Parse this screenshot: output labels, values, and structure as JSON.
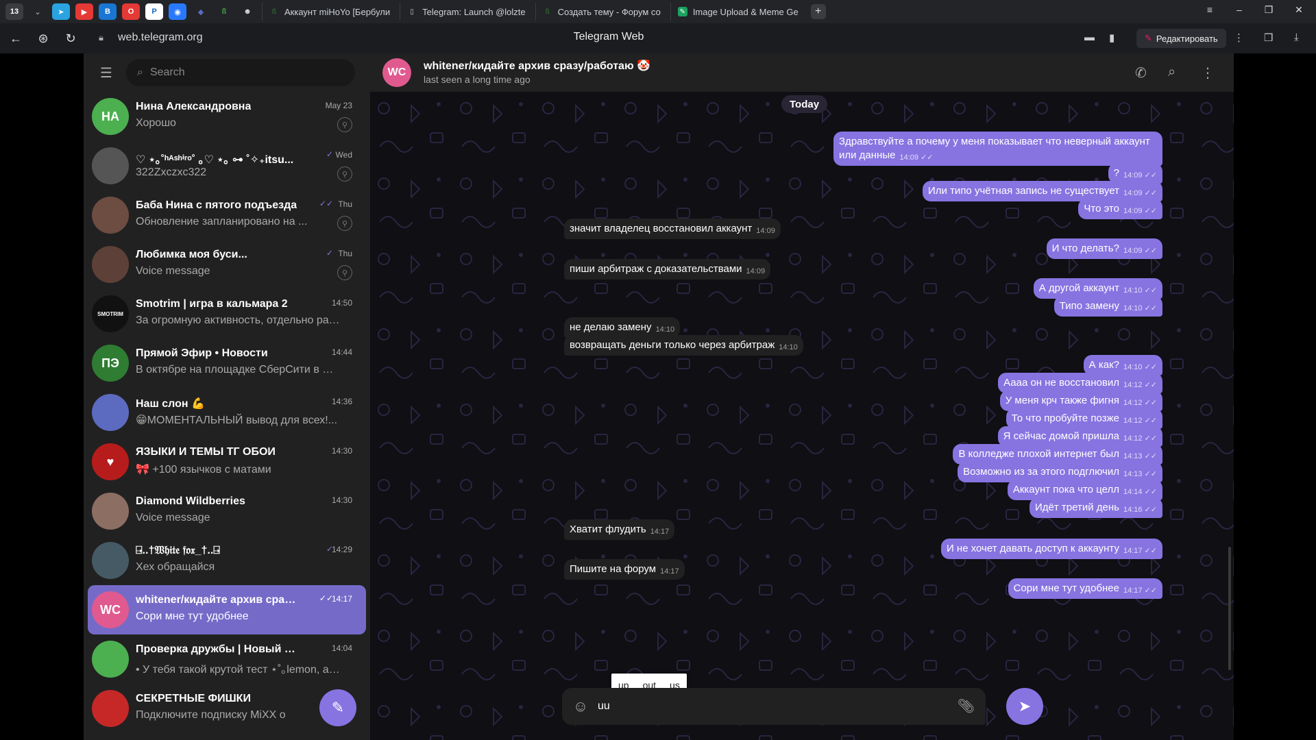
{
  "browser": {
    "tabs": [
      {
        "label": "Аккаунт miHoYo [Бербули",
        "icon": "lolz-icon",
        "color": "#2e7d32"
      },
      {
        "label": "Telegram: Launch @lolzte",
        "icon": "page-icon",
        "color": "#aaaaaa"
      },
      {
        "label": "Создать тему - Форум со",
        "icon": "lolz-icon",
        "color": "#2e7d32"
      },
      {
        "label": "Image Upload & Meme Ge",
        "icon": "imgflip-icon",
        "color": "#1aa260"
      }
    ],
    "badge_count": "13",
    "url": "web.telegram.org",
    "page_title": "Telegram Web",
    "edit_label": "Редактировать"
  },
  "sidebar": {
    "search_placeholder": "Search",
    "chats": [
      {
        "name": "Нина Александровна",
        "time": "May 23",
        "preview": "Хорошо",
        "avatar_text": "НА",
        "avatar_color": "#4caf50",
        "pinned": true,
        "check": ""
      },
      {
        "name": "♡ ⋆｡˚ʰᴬˢʰⁱʳᵒ˚ ｡♡ ⋆｡ ⊶ ˚✧₊itsu...",
        "time": "Wed",
        "preview": "322Zxczxc322",
        "avatar_text": "",
        "avatar_color": "#555555",
        "pinned": true,
        "check": "✓"
      },
      {
        "name": "Баба Нина с пятого подъезда",
        "time": "Thu",
        "preview": "Обновление запланировано на ...",
        "avatar_text": "",
        "avatar_color": "#6d4c41",
        "pinned": true,
        "check": "✓✓"
      },
      {
        "name": "Любимка моя буси...",
        "time": "Thu",
        "preview": "Voice message",
        "avatar_text": "",
        "avatar_color": "#5d4037",
        "pinned": true,
        "check": "✓"
      },
      {
        "name": "Smotrim | игра в кальмара 2",
        "time": "14:50",
        "preview": "За огромную активность, отдельно разы...",
        "avatar_text": "SMOTRIM",
        "avatar_color": "#111111",
        "pinned": false,
        "check": ""
      },
      {
        "name": "Прямой Эфир • Новости",
        "time": "14:44",
        "preview": "В октябре на площадке СберСити в Мос...",
        "avatar_text": "ПЭ",
        "avatar_color": "#2e7d32",
        "pinned": false,
        "check": ""
      },
      {
        "name": "Наш слон 💪",
        "time": "14:36",
        "preview": "😁МОМЕНТАЛЬНЫЙ вывод для всех!...",
        "avatar_text": "",
        "avatar_color": "#5c6bc0",
        "pinned": false,
        "check": ""
      },
      {
        "name": "ЯЗЫКИ И ТЕМЫ ТГ ОБОИ",
        "time": "14:30",
        "preview": "🎀 +100 язычков с матами",
        "avatar_text": "♥",
        "avatar_color": "#b71c1c",
        "pinned": false,
        "check": ""
      },
      {
        "name": "Diamond Wildberries",
        "time": "14:30",
        "preview": "Voice message",
        "avatar_text": "",
        "avatar_color": "#8d6e63",
        "pinned": false,
        "check": ""
      },
      {
        "name": "⍈..†𝔚𝔥𝔦𝔱𝔢 𝔣𝔬𝔵_†..⍈",
        "time": "14:29",
        "preview": "Хех обращайся",
        "avatar_text": "",
        "avatar_color": "#455a64",
        "pinned": false,
        "check": "✓"
      },
      {
        "name": "whitener/кидайте архив сразу...",
        "time": "14:17",
        "preview": "Сори мне тут удобнее",
        "avatar_text": "WC",
        "avatar_color": "#e05a8f",
        "pinned": false,
        "check": "✓✓",
        "active": true
      },
      {
        "name": "Проверка дружбы | Новый тест",
        "time": "14:04",
        "preview": "• У тебя такой крутой тест ⋆˚｡lemon, а ни...",
        "avatar_text": "",
        "avatar_color": "#4caf50",
        "pinned": false,
        "check": ""
      },
      {
        "name": "СЕКРЕТНЫЕ ФИШКИ",
        "time": "",
        "preview": "Подключите подписку MiXX o",
        "avatar_text": "",
        "avatar_color": "#c62828",
        "pinned": false,
        "check": ""
      }
    ]
  },
  "chat": {
    "avatar_text": "WC",
    "title": "whitener/кидайте архив сразу/работаю 🤡",
    "status": "last seen a long time ago",
    "date_label": "Today",
    "messages": [
      {
        "dir": "out",
        "text": "Здравствуйте а почему у меня показывает что неверный аккаунт или данные",
        "time": "14:09"
      },
      {
        "dir": "out",
        "text": "?",
        "time": "14:09"
      },
      {
        "dir": "out",
        "text": "Или типо учётная запись не существует",
        "time": "14:09"
      },
      {
        "dir": "out",
        "text": "Что это",
        "time": "14:09"
      },
      {
        "dir": "in",
        "text": "значит владелец восстановил аккаунт",
        "time": "14:09"
      },
      {
        "dir": "out",
        "text": "И что делать?",
        "time": "14:09"
      },
      {
        "dir": "in",
        "text": "пиши арбитраж с доказательствами",
        "time": "14:09"
      },
      {
        "dir": "out",
        "text": "А другой аккаунт",
        "time": "14:10"
      },
      {
        "dir": "out",
        "text": "Типо замену",
        "time": "14:10"
      },
      {
        "dir": "in",
        "text": "не делаю замену",
        "time": "14:10"
      },
      {
        "dir": "in",
        "text": "возвращать деньги только через арбитраж",
        "time": "14:10"
      },
      {
        "dir": "out",
        "text": "А как?",
        "time": "14:10"
      },
      {
        "dir": "out",
        "text": "Аааа он не восстановил",
        "time": "14:12"
      },
      {
        "dir": "out",
        "text": "У меня крч также фигня",
        "time": "14:12"
      },
      {
        "dir": "out",
        "text": "То что пробуйте позже",
        "time": "14:12"
      },
      {
        "dir": "out",
        "text": "Я сейчас домой пришла",
        "time": "14:12"
      },
      {
        "dir": "out",
        "text": "В колледже плохой интернет был",
        "time": "14:13"
      },
      {
        "dir": "out",
        "text": "Возможно из за этого подглючил",
        "time": "14:13"
      },
      {
        "dir": "out",
        "text": "Аккаунт пока что целл",
        "time": "14:14"
      },
      {
        "dir": "out",
        "text": "Идёт третий день",
        "time": "14:16"
      },
      {
        "dir": "in",
        "text": "Хватит флудить",
        "time": "14:17"
      },
      {
        "dir": "out",
        "text": "И не хочет давать доступ к аккаунту",
        "time": "14:17"
      },
      {
        "dir": "in",
        "text": "Пишите на форум",
        "time": "14:17"
      },
      {
        "dir": "out",
        "text": "Сори мне тут удобнее",
        "time": "14:17"
      }
    ],
    "input_value": "uu",
    "suggestions": [
      "up",
      "out",
      "us"
    ]
  },
  "colors": {
    "accent": "#8774e1",
    "panel": "#212121",
    "background": "#0f0f14"
  }
}
